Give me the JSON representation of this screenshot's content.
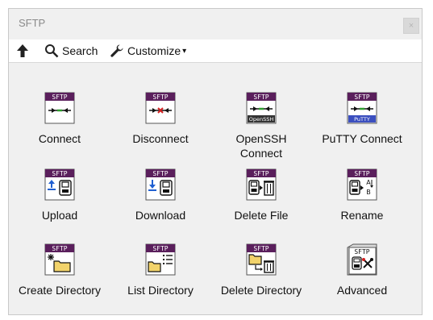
{
  "window": {
    "title": "SFTP",
    "close_glyph": "×"
  },
  "toolbar": {
    "up_icon": "up-arrow-icon",
    "search_label": "Search",
    "customize_label": "Customize",
    "caret": "▾"
  },
  "icon_badge": "SFTP",
  "items": [
    {
      "label": "Connect",
      "icon": "connect-icon"
    },
    {
      "label": "Disconnect",
      "icon": "disconnect-icon"
    },
    {
      "label": "OpenSSH",
      "label2": "Connect",
      "icon": "openssh-connect-icon",
      "sub_badge": "OpenSSH"
    },
    {
      "label": "PuTTY Connect",
      "icon": "putty-connect-icon",
      "sub_badge": "PuTTY"
    },
    {
      "label": "Upload",
      "icon": "upload-icon"
    },
    {
      "label": "Download",
      "icon": "download-icon"
    },
    {
      "label": "Delete File",
      "icon": "delete-file-icon"
    },
    {
      "label": "Rename",
      "icon": "rename-icon",
      "glyph_a": "A",
      "glyph_b": "B"
    },
    {
      "label": "Create Directory",
      "icon": "create-directory-icon"
    },
    {
      "label": "List Directory",
      "icon": "list-directory-icon"
    },
    {
      "label": "Delete Directory",
      "icon": "delete-directory-icon"
    },
    {
      "label": "Advanced",
      "icon": "advanced-icon"
    }
  ],
  "colors": {
    "badge_bg": "#5a1f5c",
    "badge_text": "#ffffff",
    "arrow_green": "#2e9e2e",
    "x_red": "#d42020",
    "blue": "#1f5fd1",
    "folder_yellow": "#f2d36b"
  }
}
